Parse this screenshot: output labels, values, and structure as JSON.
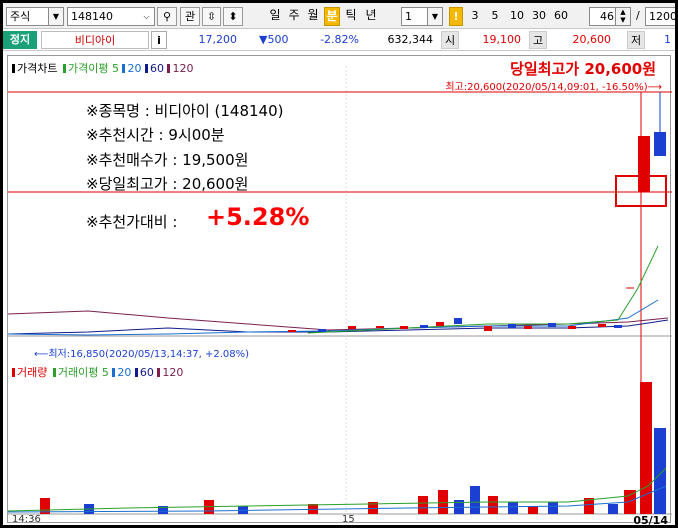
{
  "toolbar": {
    "market_select": "주식",
    "code_value": "148140",
    "zoom_icon": "magnifier-icon",
    "fav_label": "관",
    "periods": [
      "일",
      "주",
      "월",
      "분",
      "틱",
      "년"
    ],
    "active_period": "분",
    "count_value": "1",
    "minute_badge": "!",
    "minute_options": [
      "3",
      "5",
      "10",
      "30",
      "60"
    ],
    "view_count": "46",
    "slash": "/",
    "total_count": "1200"
  },
  "quote": {
    "status": "정지",
    "name": "비디아이",
    "info_label": "i",
    "price": "17,200",
    "change": "▼500",
    "change_pct": "-2.82%",
    "volume": "632,344",
    "open_label": "시",
    "open_value": "19,100",
    "high_label": "고",
    "high_value": "20,600",
    "low_label": "저",
    "low_value": "1"
  },
  "price_pane": {
    "legend_title": "가격차트",
    "ma_label": "가격이평",
    "ma_periods": [
      "5",
      "20",
      "60",
      "120"
    ],
    "ma_colors": [
      "#2aa02a",
      "#1a6fd1",
      "#111a8a",
      "#7a2050"
    ],
    "headline": "당일최고가 20,600원",
    "high_marker": "최고:20,600(2020/05/14,09:01, -16.50%)",
    "low_marker": "최저:16,850(2020/05/13,14:37, +2.08%)"
  },
  "recommendation": {
    "stock_line": "※종목명 : 비디아이 (148140)",
    "time_line": "※추천시간 : 9시00분",
    "buy_line": "※추천매수가 : 19,500원",
    "high_line": "※당일최고가 : 20,600원",
    "ratio_label": "※추천가대비 :",
    "ratio_value": "+5.28%"
  },
  "volume_pane": {
    "legend_title": "거래량",
    "ma_label": "거래이평",
    "ma_periods": [
      "5",
      "20",
      "60",
      "120"
    ]
  },
  "x_axis": {
    "labels": [
      "14:36",
      "15",
      "05/14"
    ]
  },
  "colors": {
    "up": "#e00000",
    "down": "#1a3fd1",
    "accent": "#f5b800",
    "halt": "#1aa17a"
  }
}
